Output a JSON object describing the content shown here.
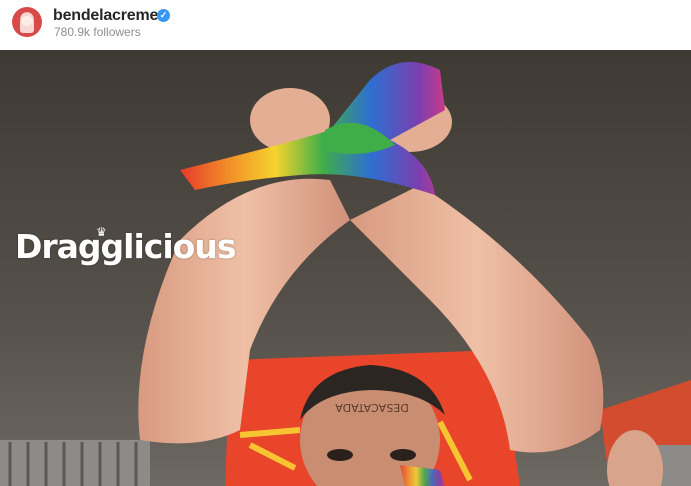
{
  "post_header": {
    "username": "bendelacreme",
    "verified_icon": "verified-badge-icon",
    "followers": "780.9k followers"
  },
  "photo": {
    "watermark_text": "Dragglicious",
    "forehead_text": "DESACATADA"
  },
  "colors": {
    "username": "#262626",
    "followers": "#8e8e8e",
    "verified": "#3897f0",
    "banner": "#e8452a"
  }
}
